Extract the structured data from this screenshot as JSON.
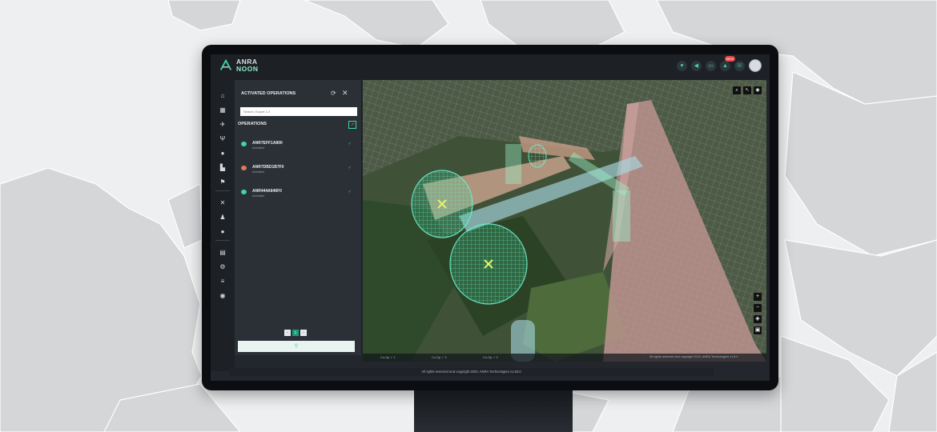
{
  "app": {
    "logo_line1": "ANRA",
    "logo_line2": "NOON"
  },
  "header": {
    "icons": [
      "shield-icon",
      "megaphone-icon",
      "chat-icon",
      "bell-icon",
      "phone-icon"
    ],
    "bell_badge": "NEW"
  },
  "sidenav": {
    "icons": [
      "home-icon",
      "grid-icon",
      "plane-icon",
      "antenna-icon",
      "circle-icon",
      "building-icon",
      "flag-icon",
      "tools-icon",
      "person-icon",
      "info-icon",
      "document-icon",
      "settings-icon",
      "list-icon",
      "location-pin-icon"
    ]
  },
  "panel": {
    "title": "ACTIVATED OPERATIONS",
    "search_placeholder": "Search, Export 1.0",
    "operations_title": "OPERATIONS",
    "operations": [
      {
        "id": "ANR7EFF1A800",
        "status": "Activated"
      },
      {
        "id": "ANR7DBD1B7F0",
        "status": "Activated"
      },
      {
        "id": "ANR444A846F0",
        "status": "Activated"
      }
    ],
    "pagination": [
      "‹",
      "1",
      "›"
    ]
  },
  "map": {
    "status_items": [
      "Co-Op ✓ 1",
      "Co-Op ✓ 3",
      "Co-Op ✓ 3"
    ],
    "copyright": "All rights reserved and copyright 2024, ANRA Technologies v1.8.0"
  },
  "footer": {
    "text": "All rights reserved and copyright 2020, ANRA Technologies v1.63.0"
  },
  "colors": {
    "accent": "#3ed6a0",
    "panel": "#2b3037",
    "topbar": "#1d2126"
  }
}
